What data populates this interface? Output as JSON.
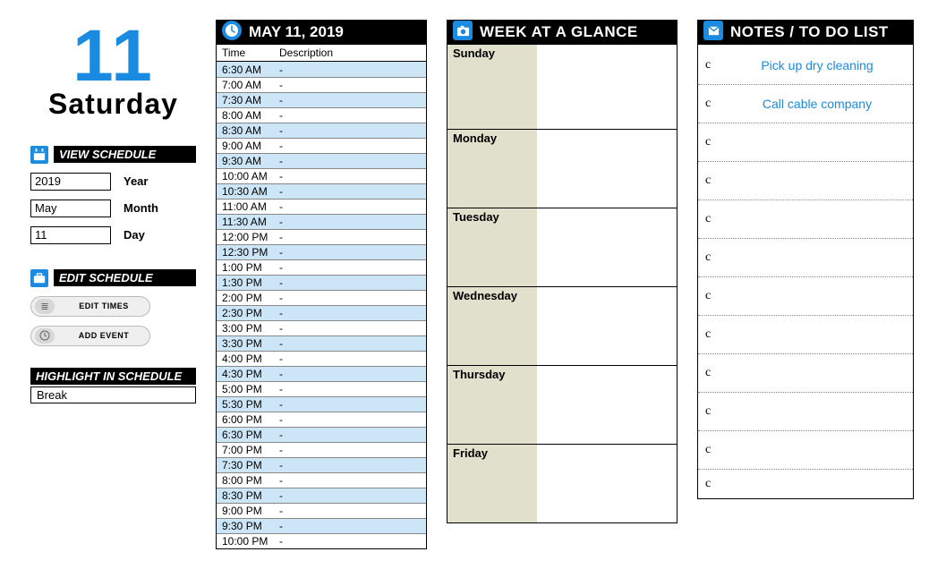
{
  "sidebar": {
    "big_num": "11",
    "big_day": "Saturday",
    "view_schedule": {
      "heading": "VIEW SCHEDULE",
      "year_label": "Year",
      "year_value": "2019",
      "month_label": "Month",
      "month_value": "May",
      "day_label": "Day",
      "day_value": "11"
    },
    "edit_schedule": {
      "heading": "EDIT SCHEDULE",
      "btn_edit_times": "EDIT TIMES",
      "btn_add_event": "ADD EVENT"
    },
    "highlight": {
      "heading": "HIGHLIGHT IN SCHEDULE",
      "value": "Break"
    }
  },
  "schedule": {
    "title": "MAY 11,  2019",
    "col_time": "Time",
    "col_desc": "Description",
    "slots": [
      {
        "time": "6:30 AM",
        "desc": "-"
      },
      {
        "time": "7:00 AM",
        "desc": "-"
      },
      {
        "time": "7:30 AM",
        "desc": "-"
      },
      {
        "time": "8:00 AM",
        "desc": "-"
      },
      {
        "time": "8:30 AM",
        "desc": "-"
      },
      {
        "time": "9:00 AM",
        "desc": "-"
      },
      {
        "time": "9:30 AM",
        "desc": "-"
      },
      {
        "time": "10:00 AM",
        "desc": "-"
      },
      {
        "time": "10:30 AM",
        "desc": "-"
      },
      {
        "time": "11:00 AM",
        "desc": "-"
      },
      {
        "time": "11:30 AM",
        "desc": "-"
      },
      {
        "time": "12:00 PM",
        "desc": "-"
      },
      {
        "time": "12:30 PM",
        "desc": "-"
      },
      {
        "time": "1:00 PM",
        "desc": "-"
      },
      {
        "time": "1:30 PM",
        "desc": "-"
      },
      {
        "time": "2:00 PM",
        "desc": "-"
      },
      {
        "time": "2:30 PM",
        "desc": "-"
      },
      {
        "time": "3:00 PM",
        "desc": "-"
      },
      {
        "time": "3:30 PM",
        "desc": "-"
      },
      {
        "time": "4:00 PM",
        "desc": "-"
      },
      {
        "time": "4:30 PM",
        "desc": "-"
      },
      {
        "time": "5:00 PM",
        "desc": "-"
      },
      {
        "time": "5:30 PM",
        "desc": "-"
      },
      {
        "time": "6:00 PM",
        "desc": "-"
      },
      {
        "time": "6:30 PM",
        "desc": "-"
      },
      {
        "time": "7:00 PM",
        "desc": "-"
      },
      {
        "time": "7:30 PM",
        "desc": "-"
      },
      {
        "time": "8:00 PM",
        "desc": "-"
      },
      {
        "time": "8:30 PM",
        "desc": "-"
      },
      {
        "time": "9:00 PM",
        "desc": "-"
      },
      {
        "time": "9:30 PM",
        "desc": "-"
      },
      {
        "time": "10:00 PM",
        "desc": "-"
      }
    ]
  },
  "week": {
    "title": "WEEK AT A GLANCE",
    "days": [
      "Sunday",
      "Monday",
      "Tuesday",
      "Wednesday",
      "Thursday",
      "Friday"
    ]
  },
  "notes": {
    "title": "NOTES / TO DO LIST",
    "items": [
      {
        "mark": "c",
        "text": "Pick up dry cleaning"
      },
      {
        "mark": "c",
        "text": "Call cable company"
      },
      {
        "mark": "c",
        "text": ""
      },
      {
        "mark": "c",
        "text": ""
      },
      {
        "mark": "c",
        "text": ""
      },
      {
        "mark": "c",
        "text": ""
      },
      {
        "mark": "c",
        "text": ""
      },
      {
        "mark": "c",
        "text": ""
      },
      {
        "mark": "c",
        "text": ""
      },
      {
        "mark": "c",
        "text": ""
      },
      {
        "mark": "c",
        "text": ""
      },
      {
        "mark": "c",
        "text": ""
      }
    ]
  }
}
